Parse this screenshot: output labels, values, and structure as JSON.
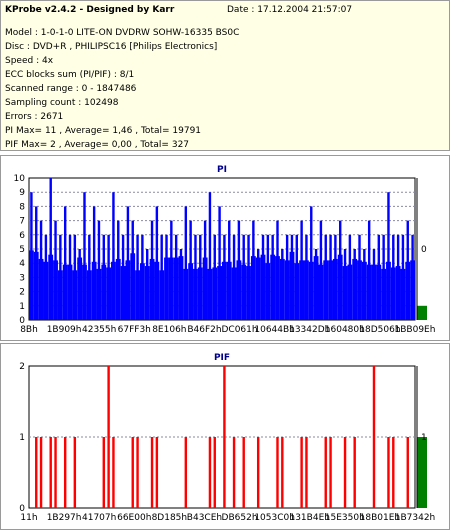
{
  "info": {
    "title": "KProbe v2.4.2 - Designed by Karr",
    "date": "Date : 17.12.2004 21:57:07",
    "lines": [
      "Model : 1-0-1-0 LITE-ON DVDRW SOHW-16335 BS0C",
      "Disc : DVD+R , PHILIPSC16 [Philips Electronics]",
      "Speed : 4x",
      "ECC blocks sum (PI/PIF) : 8/1",
      "Scanned range : 0 - 1847486",
      "Sampling count : 102498",
      "Errors : 2671",
      "PI Max= 11 , Average= 1,46 , Total= 19791",
      "PIF Max= 2 , Average= 0,00 , Total= 327"
    ]
  },
  "colors": {
    "pi": "#0000ff",
    "pif": "#ff0000",
    "green": "#008000",
    "panelTitle": "#00008b"
  },
  "chart_data": [
    {
      "type": "bar",
      "title": "PI",
      "ylim": [
        0,
        10
      ],
      "y_ticks": [
        "0",
        "1",
        "2",
        "3",
        "4",
        "5",
        "6",
        "7",
        "8",
        "9",
        "10"
      ],
      "right_axis_label": "0",
      "x_tick_labels": [
        "8Bh",
        "1B909h",
        "42355h",
        "67FF3h",
        "8E106h",
        "B46F2h",
        "DC061h",
        "10644Bh",
        "13342Dh",
        "160480h",
        "18D506h",
        "1BB09Eh"
      ],
      "series": [
        {
          "values": [
            4.9,
            4.8,
            4.3,
            4.1,
            4.6,
            4.2,
            3.5,
            3.9,
            3.9,
            3.5,
            4.4,
            3.9,
            3.5,
            4.1,
            3.6,
            3.9,
            3.7,
            4.1,
            4.3,
            3.8,
            4.2,
            4.7,
            3.5,
            4.0,
            3.8,
            4.3,
            4.1,
            3.5,
            4.4,
            4.4,
            4.4,
            4.5,
            3.6,
            4.0,
            3.6,
            3.7,
            4.4,
            3.6,
            3.7,
            3.8,
            4.1,
            4.1,
            3.7,
            4.2,
            3.9,
            3.8,
            4.5,
            4.4,
            4.6,
            4.0,
            4.6,
            4.5,
            4.3,
            4.2,
            4.8,
            4.0,
            4.2,
            4.2,
            4.1,
            4.5,
            3.9,
            4.2,
            4.2,
            4.3,
            4.6,
            3.8,
            3.9,
            4.3,
            4.2,
            4.1,
            3.9,
            3.9,
            3.9,
            3.6,
            4.1,
            3.7,
            3.8,
            3.6,
            4.1,
            4.2
          ]
        },
        {
          "values": [
            9,
            8,
            7,
            6,
            10,
            7,
            6,
            8,
            6,
            6,
            5,
            9,
            6,
            8,
            7,
            6,
            6,
            9,
            7,
            6,
            8,
            7,
            6,
            6,
            5,
            7,
            8,
            6,
            6,
            7,
            6,
            5,
            8,
            7,
            6,
            6,
            7,
            9,
            6,
            8,
            6,
            7,
            6,
            7,
            6,
            6,
            7,
            5,
            6,
            6,
            6,
            7,
            5,
            6,
            6,
            6,
            7,
            6,
            8,
            5,
            7,
            6,
            6,
            6,
            7,
            5,
            6,
            5,
            6,
            5,
            7,
            5,
            6,
            6,
            9,
            6,
            6,
            6,
            7,
            6
          ]
        }
      ]
    },
    {
      "type": "bar",
      "title": "PIF",
      "ylim": [
        0,
        2
      ],
      "y_ticks": [
        "0",
        "1",
        "2"
      ],
      "right_axis_label": "1",
      "x_tick_labels": [
        "11h",
        "1B297h",
        "41707h",
        "66E00h",
        "8D185h",
        "B43CEh",
        "DB652h",
        "1053C0h",
        "131B4Eh",
        "15E350h",
        "18B01Eh",
        "1B7342h"
      ],
      "series": [
        {
          "values": [
            0,
            1,
            1,
            0,
            1,
            1,
            0,
            1,
            0,
            1,
            0,
            0,
            0,
            0,
            0,
            1,
            0,
            1,
            0,
            0,
            0,
            1,
            1,
            0,
            0,
            1,
            1,
            0,
            0,
            0,
            0,
            0,
            1,
            0,
            0,
            0,
            0,
            1,
            1,
            0,
            0,
            0,
            1,
            0,
            1,
            0,
            0,
            1,
            0,
            0,
            0,
            1,
            1,
            0,
            0,
            0,
            1,
            1,
            0,
            0,
            0,
            1,
            1,
            0,
            0,
            1,
            0,
            1,
            0,
            0,
            0,
            1,
            0,
            0,
            1,
            1,
            0,
            0,
            1,
            0
          ]
        },
        {
          "values": [
            0,
            0,
            0,
            0,
            0,
            0,
            0,
            0,
            0,
            0,
            0,
            0,
            0,
            0,
            0,
            0,
            2,
            0,
            0,
            0,
            0,
            0,
            0,
            0,
            0,
            0,
            0,
            0,
            0,
            0,
            0,
            0,
            0,
            0,
            0,
            0,
            0,
            0,
            0,
            0,
            2,
            0,
            0,
            0,
            0,
            0,
            0,
            0,
            0,
            0,
            0,
            0,
            0,
            0,
            0,
            0,
            0,
            0,
            0,
            0,
            0,
            0,
            0,
            0,
            0,
            0,
            0,
            0,
            0,
            0,
            0,
            2,
            0,
            0,
            0,
            0,
            0,
            0,
            0,
            0
          ]
        }
      ]
    }
  ]
}
